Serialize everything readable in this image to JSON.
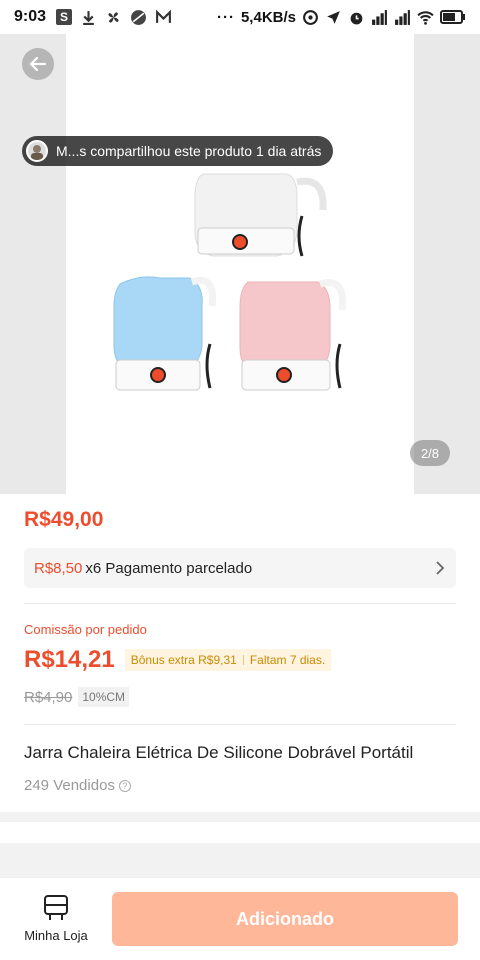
{
  "status_bar": {
    "time": "9:03",
    "speed": "5,4KB/s",
    "icons": [
      "s-app-icon",
      "download-icon",
      "fan-icon",
      "circle-app-icon",
      "mail-icon",
      "more-dots-icon",
      "at-icon",
      "location-icon",
      "alarm-icon",
      "signal-icon",
      "signal-icon",
      "wifi-icon",
      "battery-icon"
    ]
  },
  "gallery": {
    "share_text": "M...s compartilhou este produto 1 dia atrás",
    "counter": "2/8",
    "kettle_colors": {
      "top": "#f1f1f1",
      "left": "#a8d8f5",
      "right": "#f6c7ca",
      "accent": "#ee4d2d"
    }
  },
  "product": {
    "price": "R$49,00",
    "installment_price": "R$8,50",
    "installment_text": "x6 Pagamento parcelado",
    "commission_label": "Comissão por pedido",
    "commission_value": "R$14,21",
    "bonus_text": "Bônus extra R$9,31",
    "bonus_days": "Faltam 7 dias.",
    "old_commission": "R$4,90",
    "cm_tag": "10%CM",
    "title": "Jarra Chaleira Elétrica De Silicone Dobrável Portátil",
    "sold": "249 Vendidos"
  },
  "bottom_bar": {
    "store_label": "Minha Loja",
    "add_button": "Adicionado"
  },
  "colors": {
    "accent": "#ee4d2d",
    "button_disabled": "#ffb79a"
  }
}
